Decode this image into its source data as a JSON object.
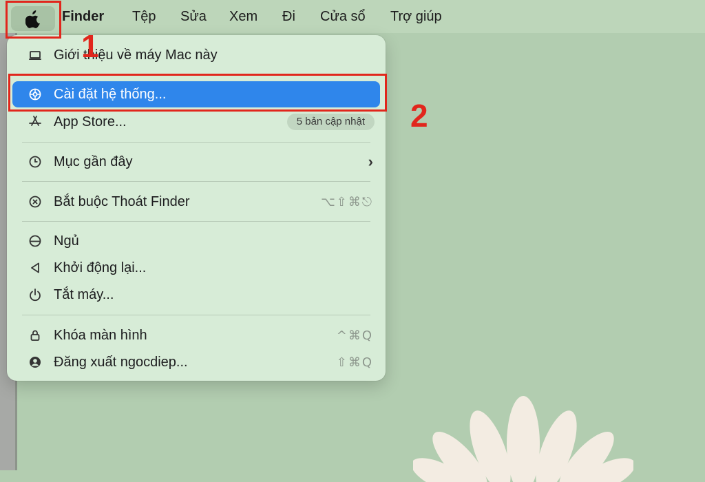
{
  "menubar": {
    "apple_icon": "apple-logo-icon",
    "app_name": "Finder",
    "items": [
      "Tệp",
      "Sửa",
      "Xem",
      "Đi",
      "Cửa sổ",
      "Trợ giúp"
    ]
  },
  "apple_menu": {
    "about": {
      "label": "Giới thiệu về máy Mac này",
      "icon": "laptop-icon"
    },
    "settings": {
      "label": "Cài đặt hệ thống...",
      "icon": "gear-icon",
      "selected": true
    },
    "app_store": {
      "label": "App Store...",
      "icon": "app-store-icon",
      "badge": "5 bản cập nhật"
    },
    "recent": {
      "label": "Mục gần đây",
      "icon": "clock-icon"
    },
    "force_quit": {
      "label": "Bắt buộc Thoát Finder",
      "icon": "force-quit-icon",
      "shortcut": "⌥⇧⌘⎋"
    },
    "sleep": {
      "label": "Ngủ",
      "icon": "sleep-icon"
    },
    "restart": {
      "label": "Khởi động lại...",
      "icon": "restart-icon"
    },
    "shutdown": {
      "label": "Tắt máy...",
      "icon": "power-icon"
    },
    "lock": {
      "label": "Khóa màn hình",
      "icon": "lock-icon",
      "shortcut": "^⌘Q"
    },
    "logout": {
      "label": "Đăng xuất ngocdiep...",
      "icon": "user-icon",
      "shortcut": "⇧⌘Q"
    }
  },
  "annotations": {
    "step1": "1",
    "step2": "2"
  },
  "colors": {
    "highlight": "#2f86eb",
    "annotation": "#e1261c",
    "menu_bg": "#d7ecd7",
    "desktop": "#b2cdb0"
  }
}
